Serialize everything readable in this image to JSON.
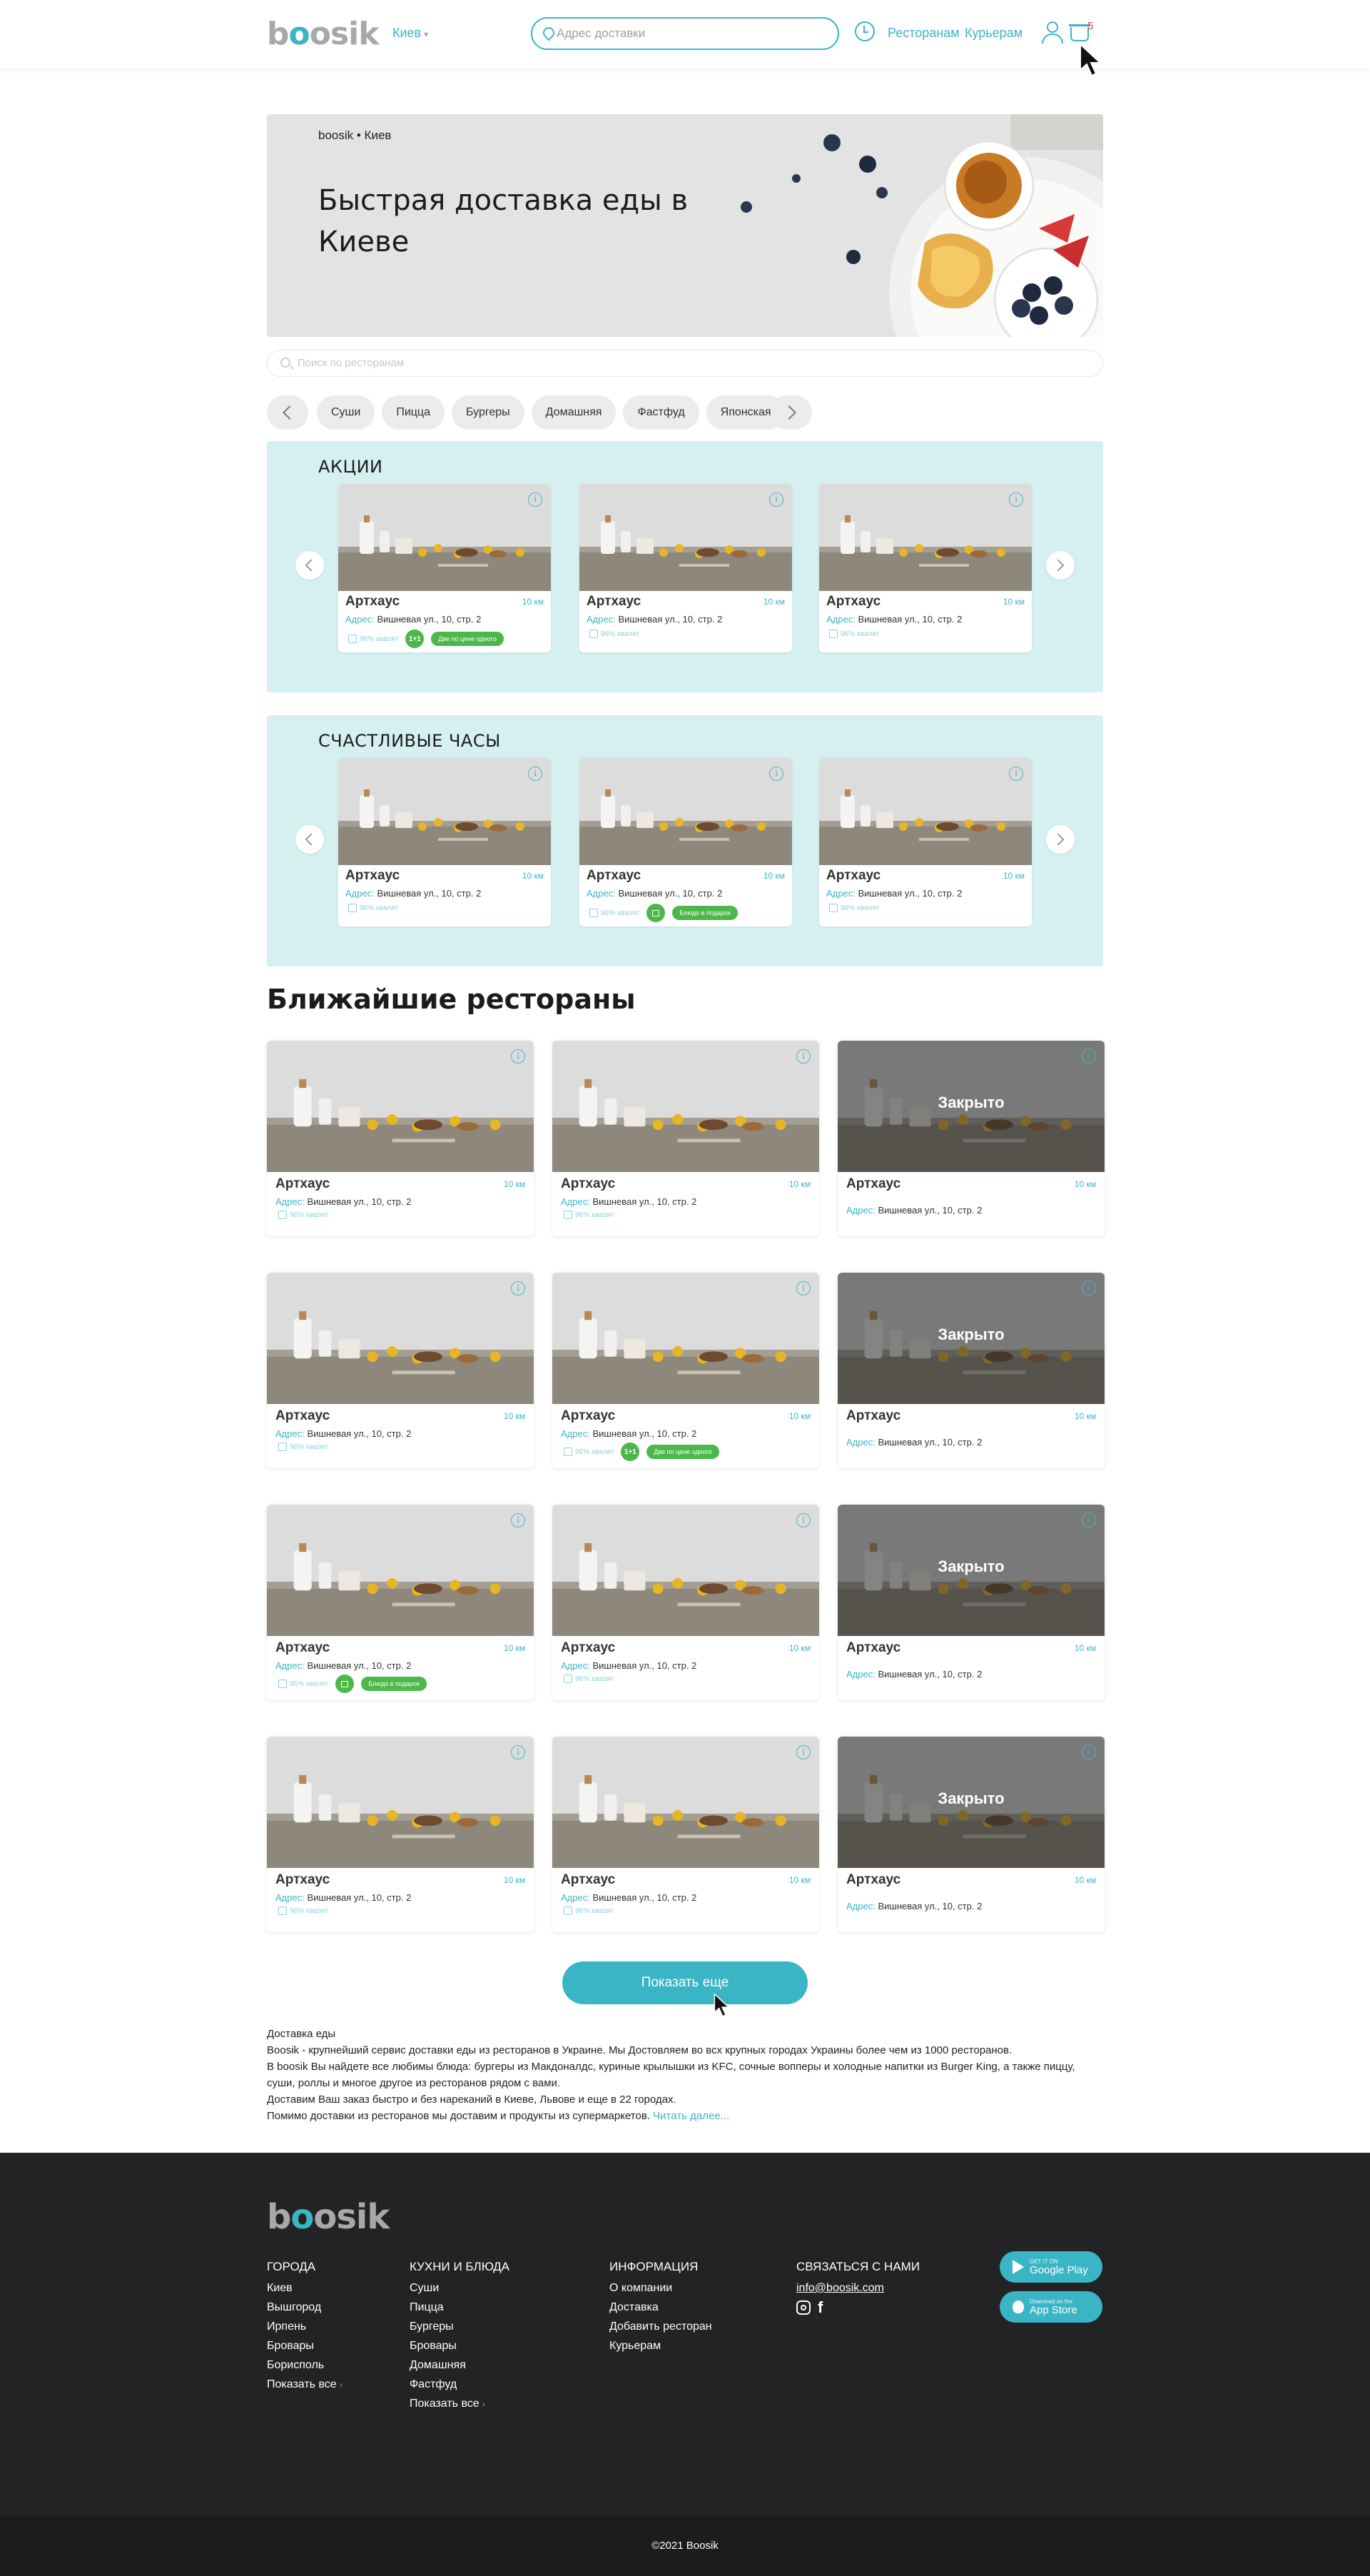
{
  "header": {
    "logo": "boosik",
    "city": "Киев",
    "address_placeholder": "Адрес доставки",
    "nav": [
      "Ресторанам",
      "Курьерам"
    ],
    "basket_count": "5"
  },
  "hero": {
    "brand_line": "boosik • Киев",
    "title": "Быстрая доставка еды в Киеве"
  },
  "search": {
    "placeholder": "Поиск по ресторанам"
  },
  "categories": [
    "Суши",
    "Пицца",
    "Бургеры",
    "Домашняя",
    "Фастфуд",
    "Японская"
  ],
  "promo_sections": [
    {
      "title": "АКЦИИ",
      "cards": [
        {
          "name": "Артхаус",
          "distance": "10 км",
          "address_label": "Адрес:",
          "address": "Вишневая ул., 10, стр. 2",
          "like": "96% хвалят",
          "badge_circle": "1+1",
          "badge_pill": "Две по цене одного"
        },
        {
          "name": "Артхаус",
          "distance": "10 км",
          "address_label": "Адрес:",
          "address": "Вишневая ул., 10, стр. 2",
          "like": "96% хвалят"
        },
        {
          "name": "Артхаус",
          "distance": "10 км",
          "address_label": "Адрес:",
          "address": "Вишневая ул., 10, стр. 2",
          "like": "96% хвалят"
        }
      ]
    },
    {
      "title": "СЧАСТЛИВЫЕ ЧАСЫ",
      "cards": [
        {
          "name": "Артхаус",
          "distance": "10 км",
          "address_label": "Адрес:",
          "address": "Вишневая ул., 10, стр. 2",
          "like": "96% хвалят"
        },
        {
          "name": "Артхаус",
          "distance": "10 км",
          "address_label": "Адрес:",
          "address": "Вишневая ул., 10, стр. 2",
          "like": "96% хвалят",
          "badge_gift": true,
          "badge_pill": "Блюдо в подарок"
        },
        {
          "name": "Артхаус",
          "distance": "10 км",
          "address_label": "Адрес:",
          "address": "Вишневая ул., 10, стр. 2",
          "like": "96% хвалят"
        }
      ]
    }
  ],
  "nearest": {
    "title": "Ближайшие рестораны",
    "closed_label": "Закрыто",
    "rows": [
      [
        {
          "name": "Артхаус",
          "distance": "10 км",
          "address_label": "Адрес:",
          "address": "Вишневая ул., 10, стр. 2",
          "like": "96% хвалят"
        },
        {
          "name": "Артхаус",
          "distance": "10 км",
          "address_label": "Адрес:",
          "address": "Вишневая ул., 10, стр. 2",
          "like": "96% хвалят"
        },
        {
          "name": "Артхаус",
          "distance": "10 км",
          "address_label": "Адрес:",
          "address": "Вишневая ул., 10, стр. 2",
          "closed": true
        }
      ],
      [
        {
          "name": "Артхаус",
          "distance": "10 км",
          "address_label": "Адрес:",
          "address": "Вишневая ул., 10, стр. 2",
          "like": "96% хвалят"
        },
        {
          "name": "Артхаус",
          "distance": "10 км",
          "address_label": "Адрес:",
          "address": "Вишневая ул., 10, стр. 2",
          "like": "96% хвалят",
          "badge_circle": "1+1",
          "badge_pill": "Две по цене одного"
        },
        {
          "name": "Артхаус",
          "distance": "10 км",
          "address_label": "Адрес:",
          "address": "Вишневая ул., 10, стр. 2",
          "closed": true
        }
      ],
      [
        {
          "name": "Артхаус",
          "distance": "10 км",
          "address_label": "Адрес:",
          "address": "Вишневая ул., 10, стр. 2",
          "like": "96% хвалят",
          "badge_gift": true,
          "badge_pill": "Блюдо в подарок"
        },
        {
          "name": "Артхаус",
          "distance": "10 км",
          "address_label": "Адрес:",
          "address": "Вишневая ул., 10, стр. 2",
          "like": "96% хвалят"
        },
        {
          "name": "Артхаус",
          "distance": "10 км",
          "address_label": "Адрес:",
          "address": "Вишневая ул., 10, стр. 2",
          "closed": true
        }
      ],
      [
        {
          "name": "Артхаус",
          "distance": "10 км",
          "address_label": "Адрес:",
          "address": "Вишневая ул., 10, стр. 2",
          "like": "96% хвалят"
        },
        {
          "name": "Артхаус",
          "distance": "10 км",
          "address_label": "Адрес:",
          "address": "Вишневая ул., 10, стр. 2",
          "like": "96% хвалят"
        },
        {
          "name": "Артхаус",
          "distance": "10 км",
          "address_label": "Адрес:",
          "address": "Вишневая ул., 10, стр. 2",
          "closed": true
        }
      ]
    ],
    "show_more": "Показать еще"
  },
  "seo": {
    "title": "Доставка еды",
    "p1_brand": "Boosik",
    "p1": " - крупнейший сервис доставки еды из ресторанов в Украине. Мы Достовляем во всх крупных городах Украины более чем из 1000 ресторанов.",
    "p2": "В boosik Вы найдете все любимы блюда: бургеры из Макдоналдс, куриные крылышки из KFC, сочные вопперы и холодные напитки из Burger King, а также пиццу, суши, роллы и многое другое из ресторанов рядом с вами.",
    "p3": "Доставим Ваш заказ быстро и без нареканий в Киеве, Львове и еще в 22 городах.",
    "p4": "Помимо доставки из ресторанов мы доставим и продукты из супермаркетов.",
    "read_more": "Читать далее..."
  },
  "footer": {
    "logo": "boosik",
    "columns": [
      {
        "title": "ГОРОДА",
        "items": [
          "Киев",
          "Вышгород",
          "Ирпень",
          "Бровары",
          "Борисполь"
        ],
        "show_all": "Показать все"
      },
      {
        "title": "КУХНИ И БЛЮДА",
        "items": [
          "Суши",
          "Пицца",
          "Бургеры",
          "Бровары",
          "Домашняя",
          "Фастфуд"
        ],
        "show_all": "Показать все"
      },
      {
        "title": "ИНФОРМАЦИЯ",
        "items": [
          "О компании",
          "Доставка",
          "Добавить ресторан",
          "Курьерам"
        ]
      },
      {
        "title": "СВЯЗАТЬСЯ С НАМИ",
        "email": "info@boosik.com"
      }
    ],
    "stores": [
      {
        "small": "GET IT ON",
        "big": "Google Play"
      },
      {
        "small": "Download on the",
        "big": "App Store"
      }
    ],
    "copyright": "©2021 Boosik"
  },
  "colors": {
    "accent": "#3ab5c6",
    "promo_bg": "#d6f0f2",
    "badge_green": "#4cb84a",
    "footer_bg": "#232326"
  }
}
